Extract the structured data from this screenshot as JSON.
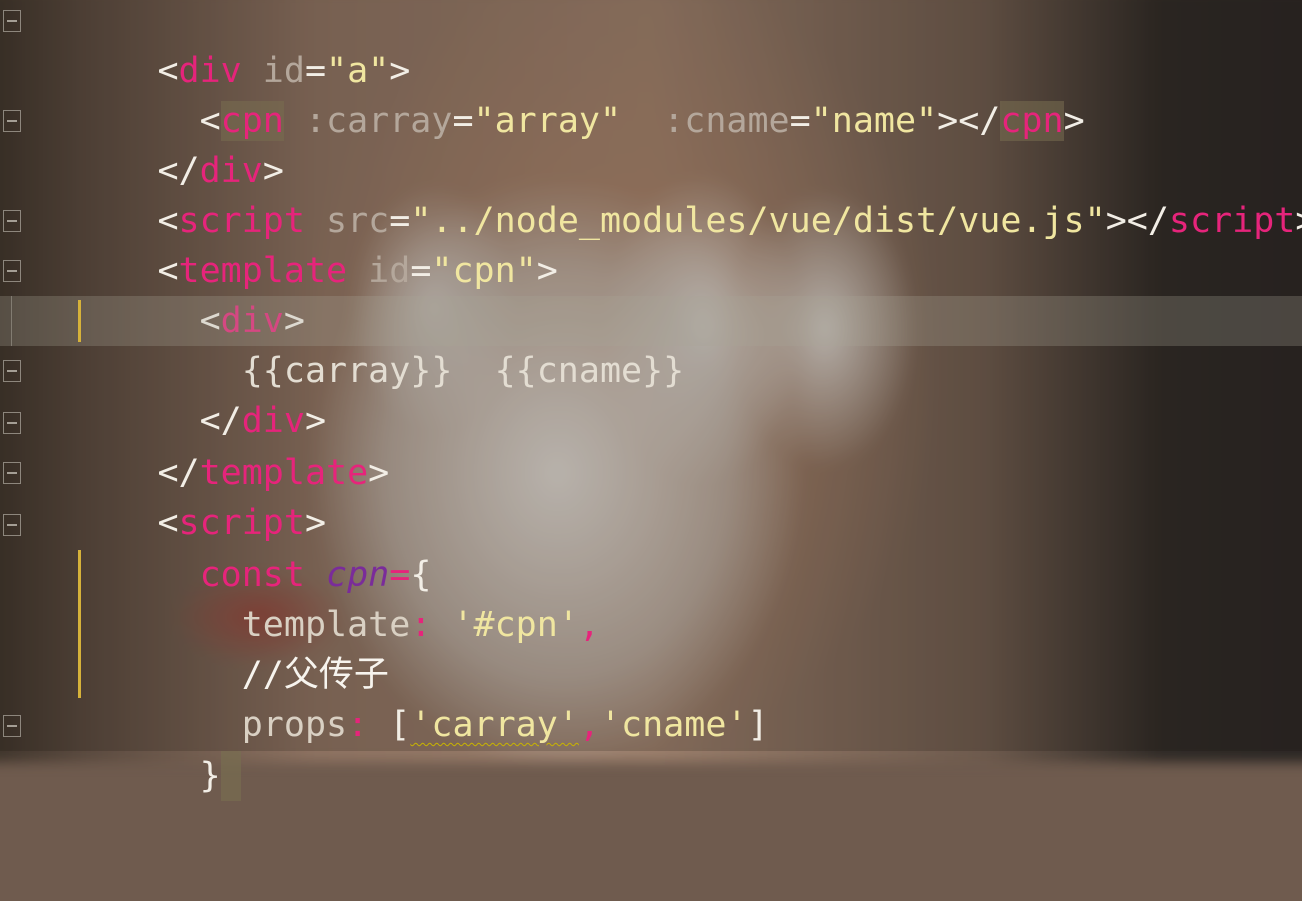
{
  "editor": {
    "lines": [
      {
        "parts": [
          [
            "p",
            "<"
          ],
          [
            "tag",
            "div"
          ],
          [
            "attr",
            " id"
          ],
          [
            "p",
            "="
          ],
          [
            "str",
            "\"a\""
          ],
          [
            "p",
            ">"
          ]
        ]
      },
      {
        "parts": [
          [
            "p",
            "  <"
          ],
          [
            "tag",
            "cpn"
          ],
          [
            "attr",
            " :carray"
          ],
          [
            "p",
            "="
          ],
          [
            "str",
            "\"array\""
          ],
          [
            "attr",
            "  :cname"
          ],
          [
            "p",
            "="
          ],
          [
            "str",
            "\"name\""
          ],
          [
            "p",
            "></"
          ],
          [
            "tag",
            "cpn"
          ],
          [
            "p",
            ">"
          ]
        ]
      },
      {
        "parts": [
          [
            "p",
            "</"
          ],
          [
            "tag",
            "div"
          ],
          [
            "p",
            ">"
          ]
        ]
      },
      {
        "parts": [
          [
            "p",
            "<"
          ],
          [
            "tag",
            "script"
          ],
          [
            "attr",
            " src"
          ],
          [
            "p",
            "="
          ],
          [
            "str",
            "\"../node_modules/vue/dist/vue.js\""
          ],
          [
            "p",
            "></"
          ],
          [
            "tag",
            "script"
          ],
          [
            "p",
            ">"
          ]
        ]
      },
      {
        "parts": [
          [
            "p",
            "<"
          ],
          [
            "tag",
            "template"
          ],
          [
            "attr",
            " id"
          ],
          [
            "p",
            "="
          ],
          [
            "str",
            "\"cpn\""
          ],
          [
            "p",
            ">"
          ]
        ]
      },
      {
        "parts": [
          [
            "p",
            "  <"
          ],
          [
            "tag",
            "div"
          ],
          [
            "p",
            ">"
          ]
        ]
      },
      {
        "parts": [
          [
            "txt",
            "    {{carray}}  {{cname}}"
          ]
        ]
      },
      {
        "parts": [
          [
            "p",
            "  </"
          ],
          [
            "tag",
            "div"
          ],
          [
            "p",
            ">"
          ]
        ]
      },
      {
        "parts": [
          [
            "p",
            "</"
          ],
          [
            "tag",
            "template"
          ],
          [
            "p",
            ">"
          ]
        ]
      },
      {
        "parts": [
          [
            "p",
            "<"
          ],
          [
            "tag",
            "script"
          ],
          [
            "p",
            ">"
          ]
        ]
      },
      {
        "parts": [
          [
            "kw",
            "  const "
          ],
          [
            "var",
            "cpn"
          ],
          [
            "op",
            "="
          ],
          [
            "p",
            "{"
          ]
        ]
      },
      {
        "parts": [
          [
            "prop",
            "    template"
          ],
          [
            "op",
            ": "
          ],
          [
            "str",
            "'#cpn'"
          ],
          [
            "op",
            ","
          ]
        ]
      },
      {
        "parts": [
          [
            "cmt",
            "    //父传子"
          ]
        ]
      },
      {
        "parts": [
          [
            "prop",
            "    props"
          ],
          [
            "op",
            ": "
          ],
          [
            "p",
            "["
          ],
          [
            "str",
            "'carray'"
          ],
          [
            "op",
            ","
          ],
          [
            "str",
            "'cname'"
          ],
          [
            "p",
            "]"
          ]
        ]
      },
      {
        "parts": [
          [
            "p",
            "  }"
          ]
        ]
      }
    ]
  }
}
